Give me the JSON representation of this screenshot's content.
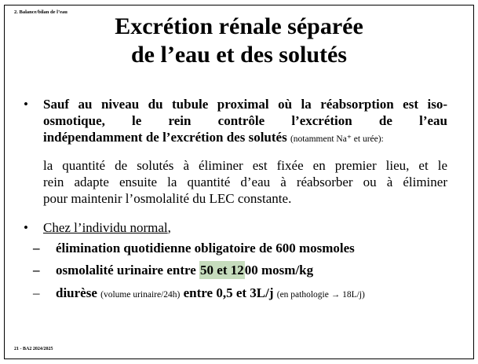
{
  "header": {
    "section_label": "2. Balance/bilan de l’eau",
    "title_line1": "Excrétion rénale séparée",
    "title_line2": "de l’eau et des solutés"
  },
  "bullets": {
    "b1_marker": "•",
    "b1_line1": "Sauf au niveau du tubule proximal où la réabsorption est iso-",
    "b1_line2": "osmotique, le rein contrôle l’excrétion de l’eau",
    "b1_line3": "indépendamment de l’excrétion des solutés",
    "b1_note": "(notamment Na⁺ et urée):",
    "b1_para_line1": "la quantité de solutés à éliminer est fixée en premier lieu, et le",
    "b1_para_line2": "rein adapte ensuite la quantité d’eau à réabsorber ou à éliminer",
    "b1_para_line3": "pour maintenir l’osmolalité du LEC constante.",
    "b2_marker": "•",
    "b2_text": "Chez l’individu normal",
    "b2_suffix": ","
  },
  "subitems": {
    "dash": "–",
    "item1": "élimination quotidienne obligatoire de 600 mosmoles",
    "item2_before": "osmolalité urinaire entre ",
    "item2_highlight": "50 et 12",
    "item2_after": "00 mosm/kg",
    "item3_bold1": "diurèse",
    "item3_note1": "(volume urinaire/24h)",
    "item3_bold2": "entre 0,5 et 3L/j",
    "item3_note2": "(en pathologie → 18L/j)"
  },
  "footer": {
    "text": "21 - BA2 2024/2025"
  },
  "colors": {
    "highlight": "#c6dcbd",
    "frame": "#000000"
  }
}
